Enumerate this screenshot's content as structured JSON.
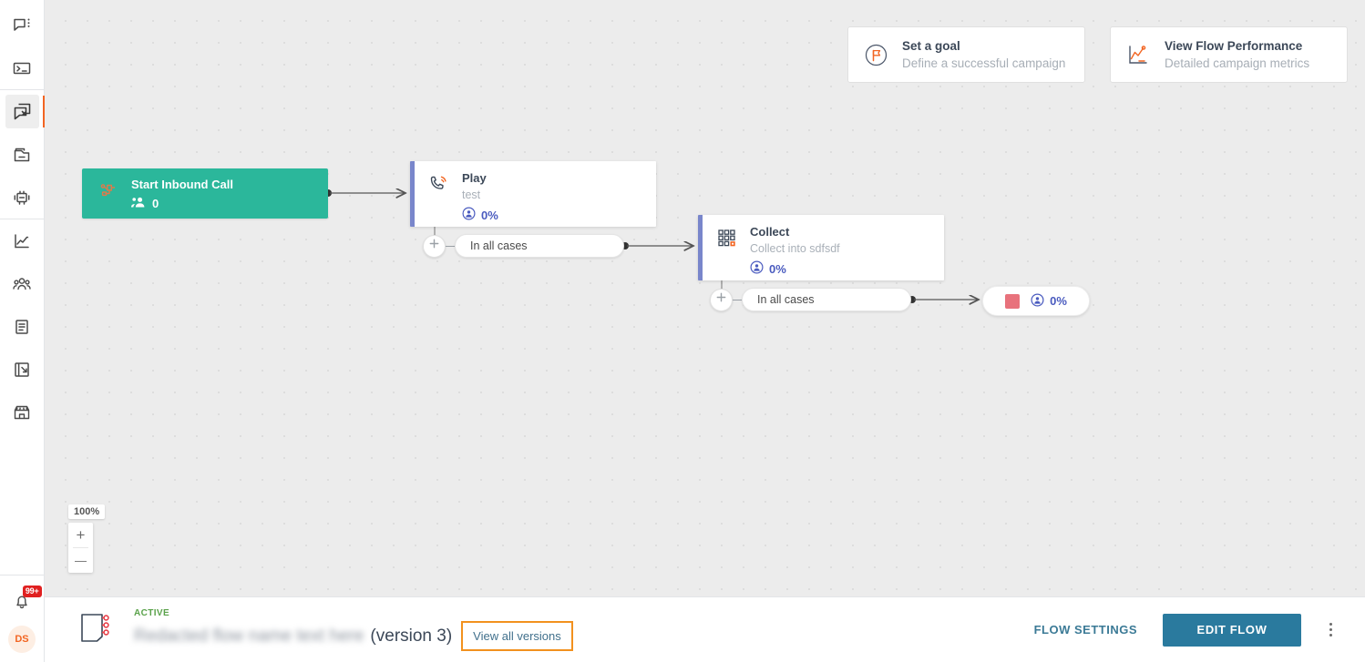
{
  "sidebar": {
    "top_items": [
      {
        "name": "chat-menu-icon",
        "label": "Conversations"
      },
      {
        "name": "terminal-icon",
        "label": "Console"
      }
    ],
    "mid_items": [
      {
        "name": "flows-icon",
        "label": "Flows",
        "active": true
      },
      {
        "name": "campaigns-icon",
        "label": "Campaigns",
        "active": false
      },
      {
        "name": "bot-icon",
        "label": "Bots",
        "active": false
      }
    ],
    "bottom_items": [
      {
        "name": "analytics-icon",
        "label": "Analytics"
      },
      {
        "name": "contacts-icon",
        "label": "Contacts"
      },
      {
        "name": "content-icon",
        "label": "Content"
      },
      {
        "name": "reports-icon",
        "label": "Reports"
      },
      {
        "name": "store-icon",
        "label": "Store"
      }
    ],
    "notifications": {
      "icon": "bell-icon",
      "badge": "99+"
    },
    "avatar": {
      "initials": "DS"
    }
  },
  "hint_cards": [
    {
      "icon": "goal-flag-icon",
      "title": "Set a goal",
      "subtitle": "Define a successful campaign"
    },
    {
      "icon": "performance-chart-icon",
      "title": "View Flow Performance",
      "subtitle": "Detailed campaign metrics"
    }
  ],
  "flow": {
    "start_node": {
      "icon": "inbound-call-icon",
      "title": "Start Inbound Call",
      "contacts_icon": "contacts-icon",
      "count": "0"
    },
    "nodes": [
      {
        "icon": "play-phone-icon",
        "title": "Play",
        "subtitle": "test",
        "metric_icon": "contact-circle-icon",
        "metric": "0%"
      },
      {
        "icon": "keypad-icon",
        "title": "Collect",
        "subtitle": "Collect into sdfsdf",
        "metric_icon": "contact-circle-icon",
        "metric": "0%"
      }
    ],
    "branches": [
      {
        "plus_icon": "plus-icon",
        "label": "In all cases"
      },
      {
        "plus_icon": "plus-icon",
        "label": "In all cases"
      }
    ],
    "end_node": {
      "swatch_color": "#e8727c",
      "metric_icon": "contact-circle-icon",
      "metric": "0%"
    }
  },
  "zoom": {
    "level": "100%",
    "zoom_in": "+",
    "zoom_out": "—"
  },
  "bottom_bar": {
    "doc_icon": "flow-document-icon",
    "status": "ACTIVE",
    "flow_name": "Redacted flow name text here",
    "version": "(version 3)",
    "view_versions_label": "View all versions",
    "flow_settings_label": "FLOW SETTINGS",
    "edit_flow_label": "EDIT FLOW",
    "overflow_icon": "kebab-menu-icon"
  },
  "colors": {
    "start_node": "#2bb79b",
    "node_accent": "#7986cb",
    "metric_text": "#4a5bbf",
    "active_indicator": "#f26522",
    "primary_button": "#2a7a9e",
    "highlight_border": "#f2911e",
    "status_active": "#5aa24a",
    "badge": "#e02020"
  }
}
